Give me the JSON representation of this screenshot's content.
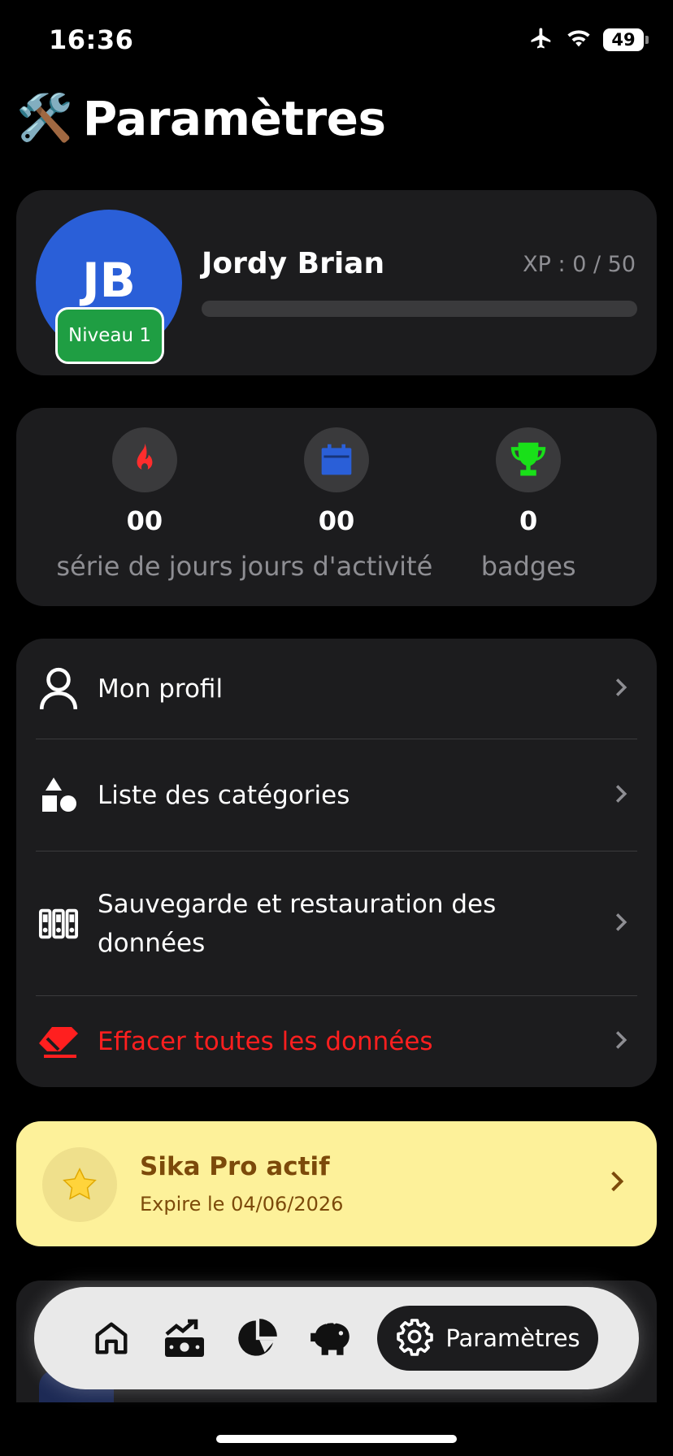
{
  "status": {
    "time": "16:36",
    "battery": "49"
  },
  "page": {
    "emoji": "🛠️",
    "title": "Paramètres"
  },
  "profile": {
    "initials": "JB",
    "level": "Niveau 1",
    "name": "Jordy Brian",
    "xp": "XP : 0 / 50",
    "xp_progress": 0
  },
  "stats": [
    {
      "value": "00",
      "label": "série de jours",
      "icon": "flame-icon",
      "color": "#ff2d2d"
    },
    {
      "value": "00",
      "label": "jours d'activité",
      "icon": "calendar-icon",
      "color": "#2a5fd8"
    },
    {
      "value": "0",
      "label": "badges",
      "icon": "trophy-icon",
      "color": "#19e019"
    }
  ],
  "menu": [
    {
      "label": "Mon profil",
      "icon": "user-icon"
    },
    {
      "label": "Liste des catégories",
      "icon": "shapes-icon"
    },
    {
      "label": "Sauvegarde et restauration des données",
      "icon": "backup-icon"
    },
    {
      "label": "Effacer toutes les données",
      "icon": "eraser-icon",
      "danger": true
    }
  ],
  "pro": {
    "title": "Sika Pro actif",
    "subtitle": "Expire le 04/06/2026",
    "icon": "star-icon"
  },
  "nav": {
    "tabs": [
      "home-icon",
      "chart-money-icon",
      "pie-chart-icon",
      "piggy-bank-icon"
    ],
    "active_label": "Paramètres",
    "active_icon": "gear-icon"
  },
  "colors": {
    "accent": "#2a5fd8",
    "danger": "#ff1f1f",
    "level_green": "#1f9e43",
    "pro_bg": "#fdf19a"
  }
}
